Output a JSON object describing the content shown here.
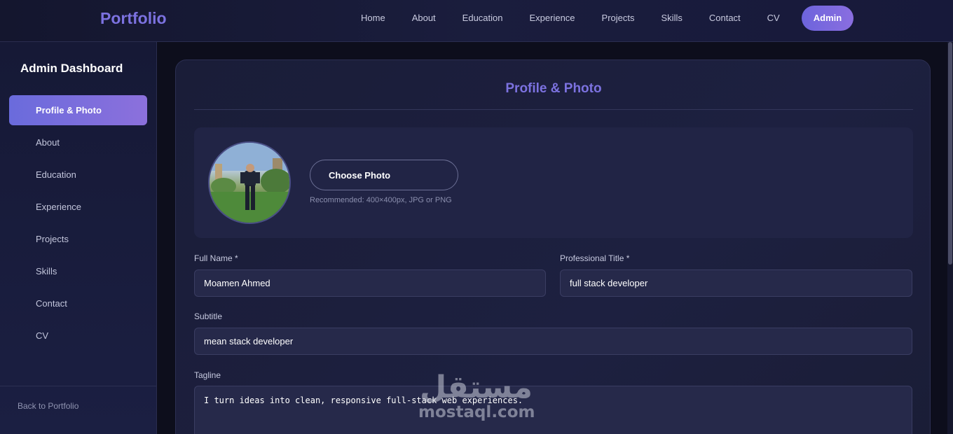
{
  "nav": {
    "brand": "Portfolio",
    "links": [
      "Home",
      "About",
      "Education",
      "Experience",
      "Projects",
      "Skills",
      "Contact",
      "CV"
    ],
    "admin": "Admin"
  },
  "sidebar": {
    "title": "Admin Dashboard",
    "items": [
      {
        "label": "Profile & Photo",
        "active": true
      },
      {
        "label": "About"
      },
      {
        "label": "Education"
      },
      {
        "label": "Experience"
      },
      {
        "label": "Projects"
      },
      {
        "label": "Skills"
      },
      {
        "label": "Contact"
      },
      {
        "label": "CV"
      }
    ],
    "back": "Back to Portfolio"
  },
  "card": {
    "title": "Profile & Photo",
    "photo": {
      "button": "Choose Photo",
      "hint": "Recommended: 400×400px, JPG or PNG"
    },
    "fields": {
      "full_name": {
        "label": "Full Name *",
        "value": "Moamen Ahmed"
      },
      "title": {
        "label": "Professional Title *",
        "value": "full stack developer"
      },
      "subtitle": {
        "label": "Subtitle",
        "value": "mean stack developer"
      },
      "tagline": {
        "label": "Tagline",
        "value": "I turn ideas into clean, responsive full-stack web experiences."
      }
    }
  },
  "watermark": {
    "arabic": "مستقل",
    "latin": "mostaql.com"
  },
  "colors": {
    "accent": "#7c72e0",
    "background": "#0f1020"
  }
}
